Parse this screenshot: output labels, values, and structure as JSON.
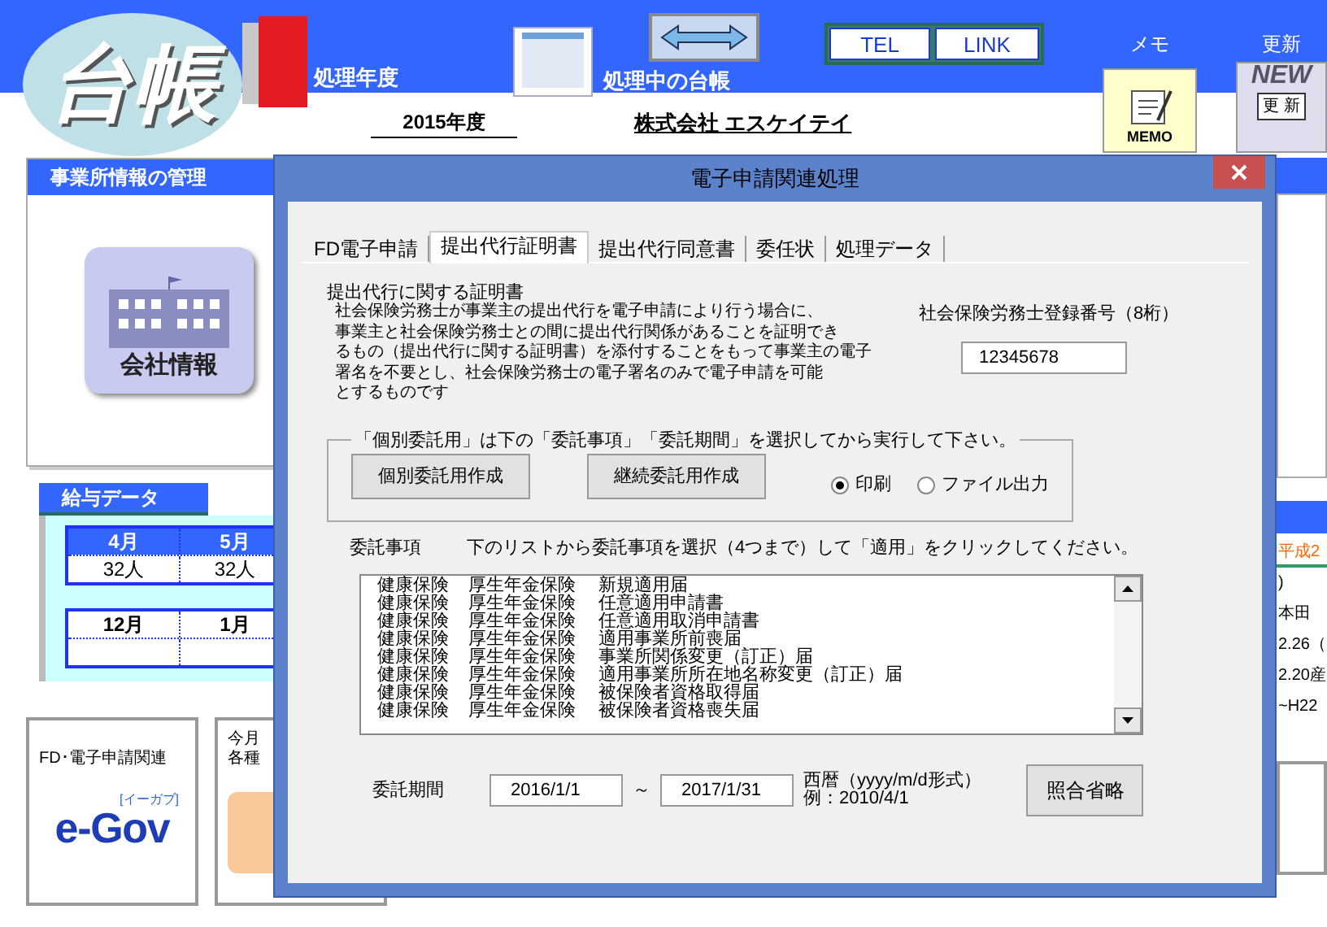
{
  "header": {
    "logo": "台帳",
    "year_label": "処理年度",
    "ledger_label": "処理中の台帳",
    "tel_button": "TEL",
    "link_button": "LINK",
    "memo_label": "メモ",
    "update_label": "更新",
    "memo_icon_text": "MEMO",
    "update_badge": "NEW",
    "update_icon_text": "更 新",
    "fiscal_year": "2015年度",
    "company": "株式会社 エスケイテイ"
  },
  "office_panel": {
    "title": "事業所情報の管理",
    "company_button": "会社情報"
  },
  "salary_panel": {
    "title": "給与データ",
    "tables": [
      {
        "columns": [
          "4月",
          "5月"
        ],
        "values": [
          "32人",
          "32人"
        ]
      },
      {
        "columns": [
          "12月",
          "1月"
        ]
      }
    ]
  },
  "bottom_cards": [
    {
      "kind": "egov",
      "title": "FD･電子申請関連",
      "logo": "e-Gov",
      "logo_sub": "[イーガブ]"
    },
    {
      "kind": "monthly",
      "title_lines": [
        "今月",
        "各種"
      ]
    }
  ],
  "right_column": {
    "header": "平成2",
    "lines": [
      ")",
      "本田",
      "2.26（",
      "2.20産",
      "~H22"
    ]
  },
  "dialog": {
    "title": "電子申請関連処理",
    "tabs": [
      {
        "label": "FD電子申請",
        "selected": false
      },
      {
        "label": "提出代行証明書",
        "selected": true
      },
      {
        "label": "提出代行同意書",
        "selected": false
      },
      {
        "label": "委任状",
        "selected": false
      },
      {
        "label": "処理データ",
        "selected": false
      }
    ],
    "heading": "提出代行に関する証明書",
    "body_lines": [
      "社会保険労務士が事業主の提出代行を電子申請により行う場合に、",
      "事業主と社会保険労務士との間に提出代行関係があることを証明でき",
      "るもの（提出代行に関する証明書）を添付することをもって事業主の電子",
      "署名を不要とし、社会保険労務士の電子署名のみで電子申請を可能",
      "とするものです"
    ],
    "reg_label": "社会保険労務士登録番号（8桁）",
    "reg_value": "12345678",
    "group_legend": "「個別委託用」は下の「委託事項」「委託期間」を選択してから実行して下さい。",
    "buttons": [
      "個別委託用作成",
      "継続委託用作成"
    ],
    "radios": [
      {
        "label": "印刷",
        "selected": true
      },
      {
        "label": "ファイル出力",
        "selected": false
      }
    ],
    "items_label": "委託事項",
    "items_hint": "下のリストから委託事項を選択（4つまで）して「適用」をクリックしてください。",
    "items": [
      [
        "健康保険",
        "厚生年金保険",
        "新規適用届"
      ],
      [
        "健康保険",
        "厚生年金保険",
        "任意適用申請書"
      ],
      [
        "健康保険",
        "厚生年金保険",
        "任意適用取消申請書"
      ],
      [
        "健康保険",
        "厚生年金保険",
        "適用事業所前喪届"
      ],
      [
        "健康保険",
        "厚生年金保険",
        "事業所関係変更（訂正）届"
      ],
      [
        "健康保険",
        "厚生年金保険",
        "適用事業所所在地名称変更（訂正）届"
      ],
      [
        "健康保険",
        "厚生年金保険",
        "被保険者資格取得届"
      ],
      [
        "健康保険",
        "厚生年金保険",
        "被保険者資格喪失届"
      ]
    ],
    "period_label": "委託期間",
    "period_from": "2016/1/1",
    "period_sep": "～",
    "period_to": "2017/1/31",
    "format_note": "西暦（yyyy/m/d形式）",
    "format_example": "例：2010/4/1",
    "skip_button": "照合省略"
  }
}
